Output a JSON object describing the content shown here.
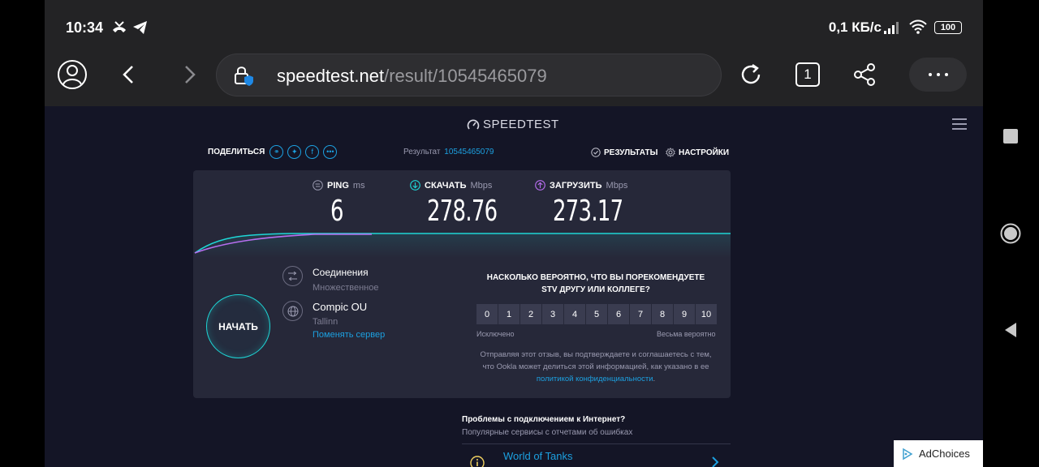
{
  "status_bar": {
    "time": "10:34",
    "net_speed": "0,1 КБ/с",
    "battery": "100"
  },
  "browser": {
    "url_host": "speedtest.net",
    "url_path": "/result/10545465079",
    "tab_count": "1"
  },
  "speedtest": {
    "logo": "SPEEDTEST",
    "share_label": "ПОДЕЛИТЬСЯ",
    "result_label": "Результат",
    "result_id": "10545465079",
    "results_link": "РЕЗУЛЬТАТЫ",
    "settings_link": "НАСТРОЙКИ",
    "ping": {
      "label": "PING",
      "unit": "ms",
      "value": "6"
    },
    "download": {
      "label": "СКАЧАТЬ",
      "unit": "Mbps",
      "value": "278.76"
    },
    "upload": {
      "label": "ЗАГРУЗИТЬ",
      "unit": "Mbps",
      "value": "273.17"
    },
    "start_button": "НАЧАТЬ",
    "connections_title": "Соединения",
    "connections_value": "Множественное",
    "provider_name": "Compic OU",
    "provider_city": "Tallinn",
    "change_server": "Поменять сервер",
    "nps": {
      "question": "НАСКОЛЬКО ВЕРОЯТНО, ЧТО ВЫ ПОРЕКОМЕНДУЕТЕ STV ДРУГУ ИЛИ КОЛЛЕГЕ?",
      "scale": [
        "0",
        "1",
        "2",
        "3",
        "4",
        "5",
        "6",
        "7",
        "8",
        "9",
        "10"
      ],
      "low_label": "Исключено",
      "high_label": "Весьма вероятно",
      "disclaimer": "Отправляя этот отзыв, вы подтверждаете и соглашаетесь с тем, что Ookla может делиться этой информацией, как указано в ее",
      "link": "политикой конфиденциальности",
      "link_suffix": "."
    },
    "problems_title": "Проблемы с подключением к Интернет?",
    "problems_sub": "Популярные сервисы с отчетами об ошибках",
    "service_name": "World of Tanks"
  },
  "ad": {
    "label": "AdChoices"
  },
  "colors": {
    "page_bg": "#141526",
    "card_bg": "#262839",
    "accent_cyan": "#1ed6d6",
    "accent_blue": "#1ca0e0",
    "upload_purple": "#b86ef0"
  }
}
